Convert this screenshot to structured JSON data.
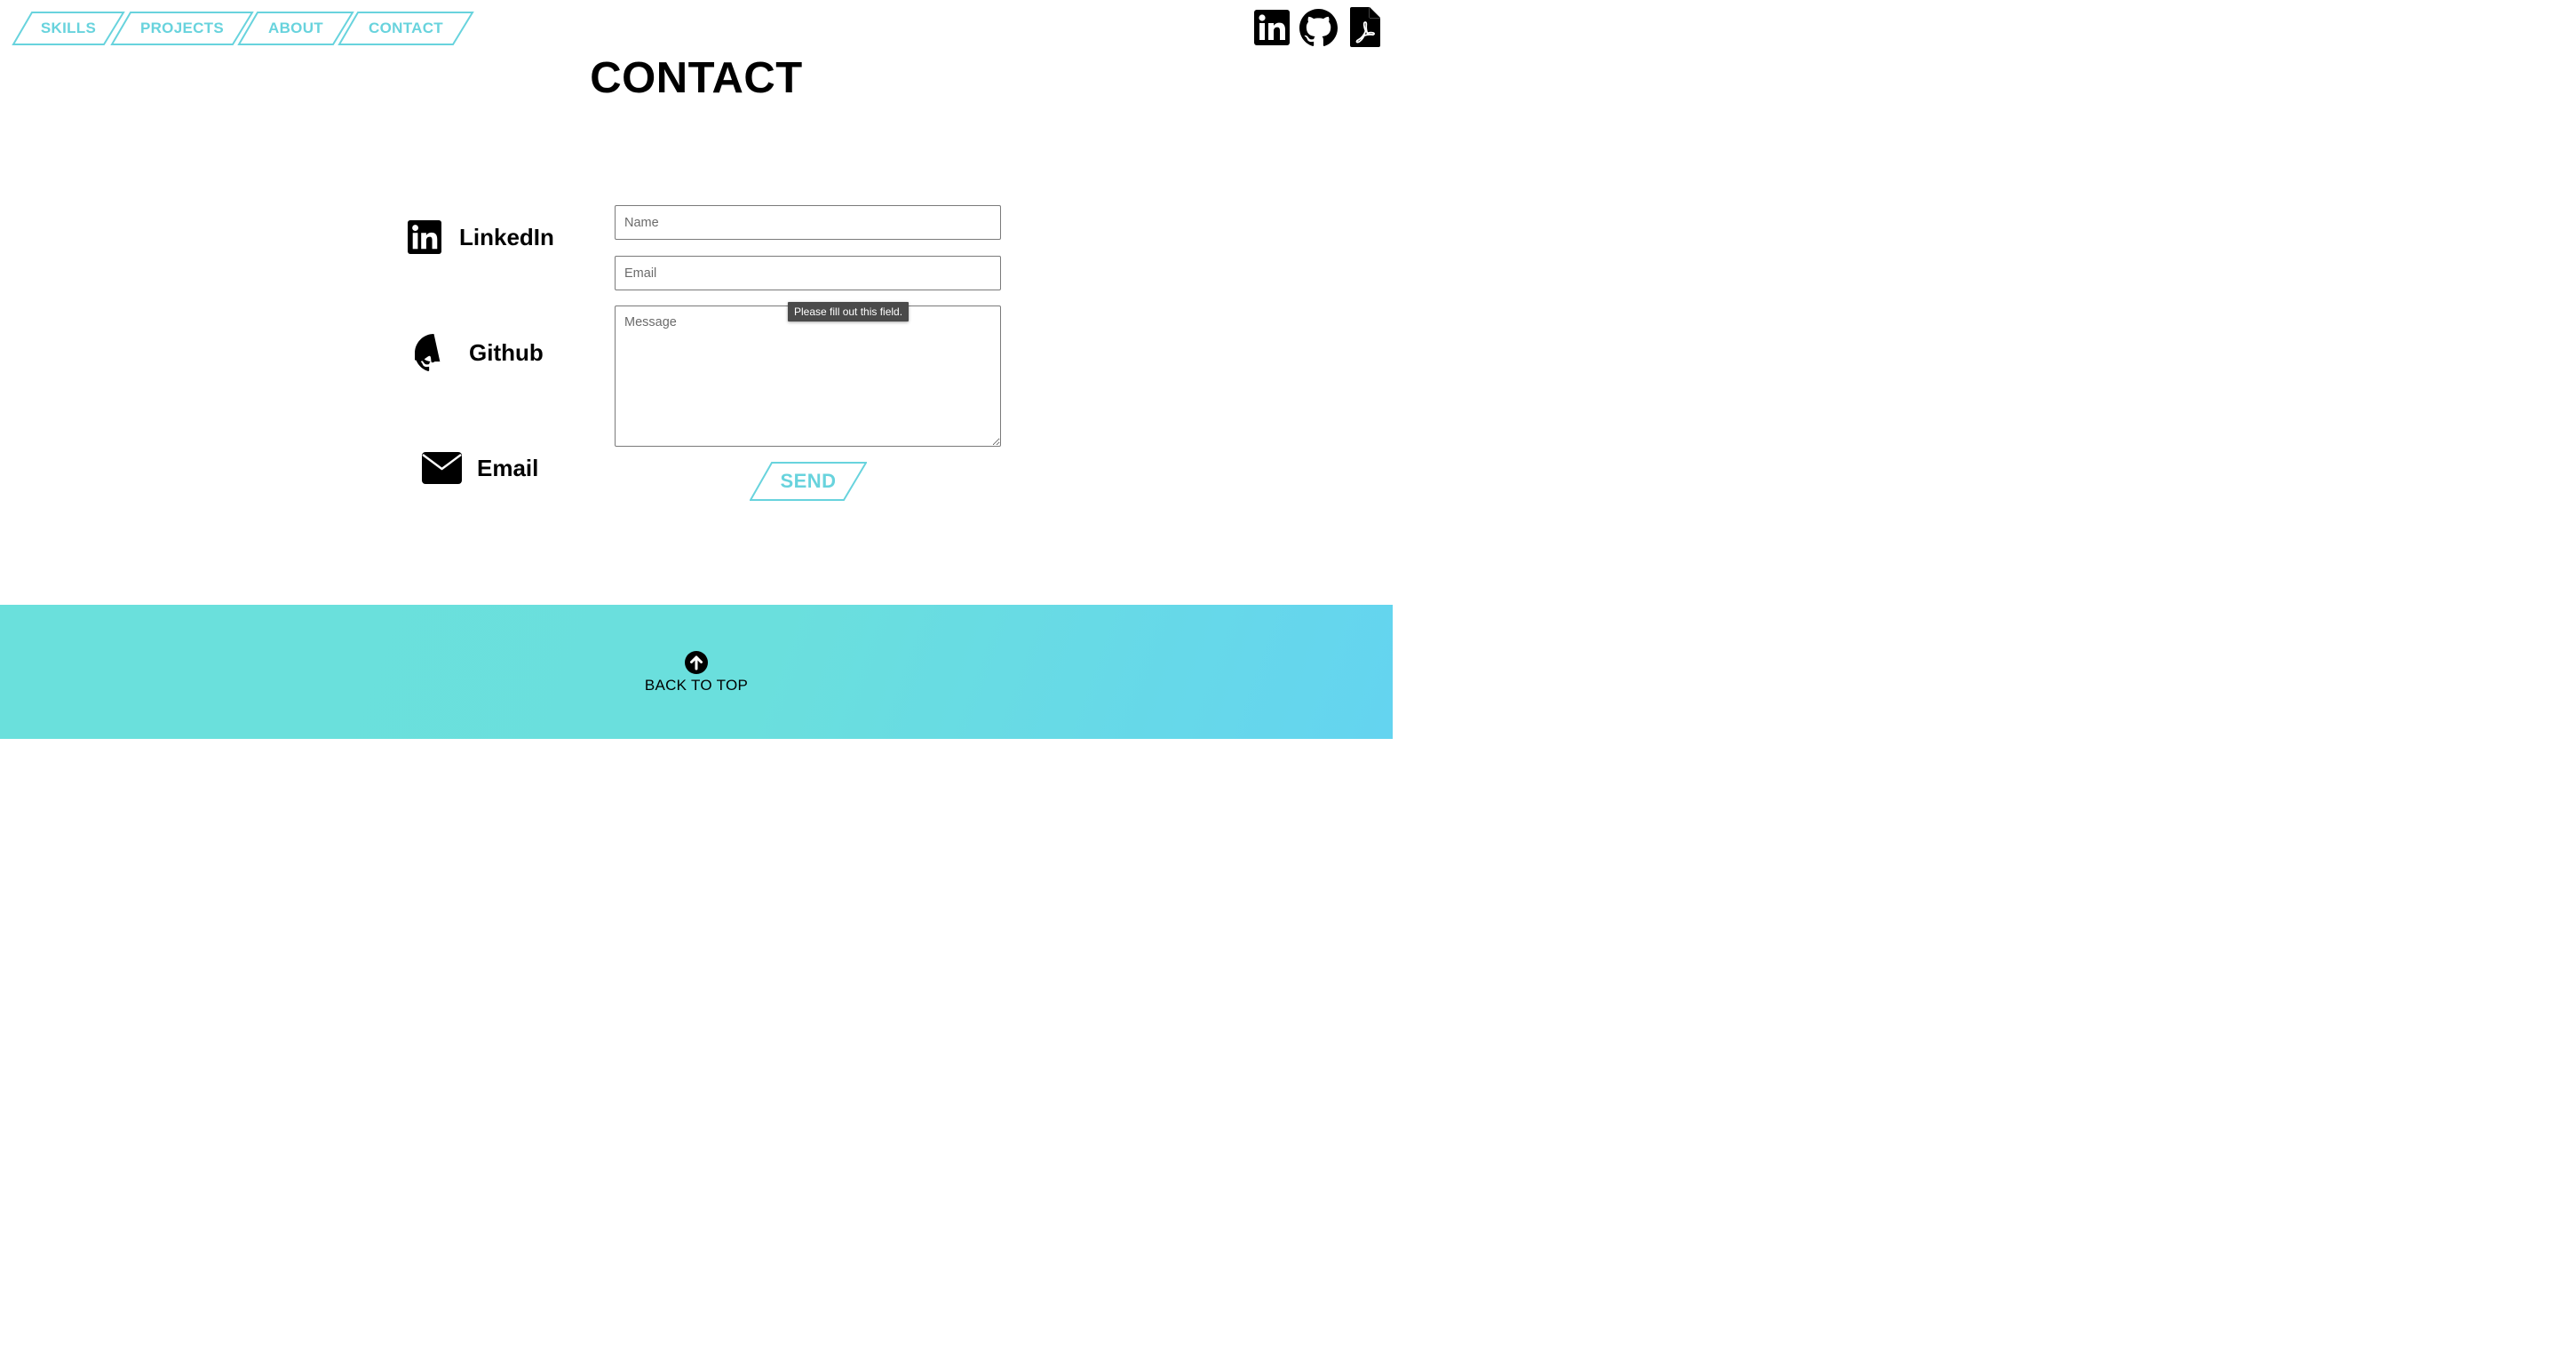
{
  "nav": {
    "items": [
      {
        "label": "SKILLS"
      },
      {
        "label": "PROJECTS"
      },
      {
        "label": "ABOUT"
      },
      {
        "label": "CONTACT"
      }
    ]
  },
  "header_icons": [
    "linkedin-icon",
    "github-icon",
    "pdf-icon"
  ],
  "main": {
    "title": "CONTACT",
    "links": [
      {
        "label": "LinkedIn",
        "icon": "linkedin-icon"
      },
      {
        "label": "Github",
        "icon": "github-icon"
      },
      {
        "label": "Email",
        "icon": "envelope-icon"
      }
    ]
  },
  "form": {
    "name_placeholder": "Name",
    "email_placeholder": "Email",
    "message_placeholder": "Message",
    "validation_tooltip": "Please fill out this field.",
    "send_label": "SEND"
  },
  "footer": {
    "back_to_top_label": "BACK TO TOP",
    "icon": "arrow-up-circle-icon"
  },
  "colors": {
    "accent": "#68d3dd",
    "footer_gradient_start": "#6ae0dc",
    "footer_gradient_end": "#64d4f0"
  }
}
